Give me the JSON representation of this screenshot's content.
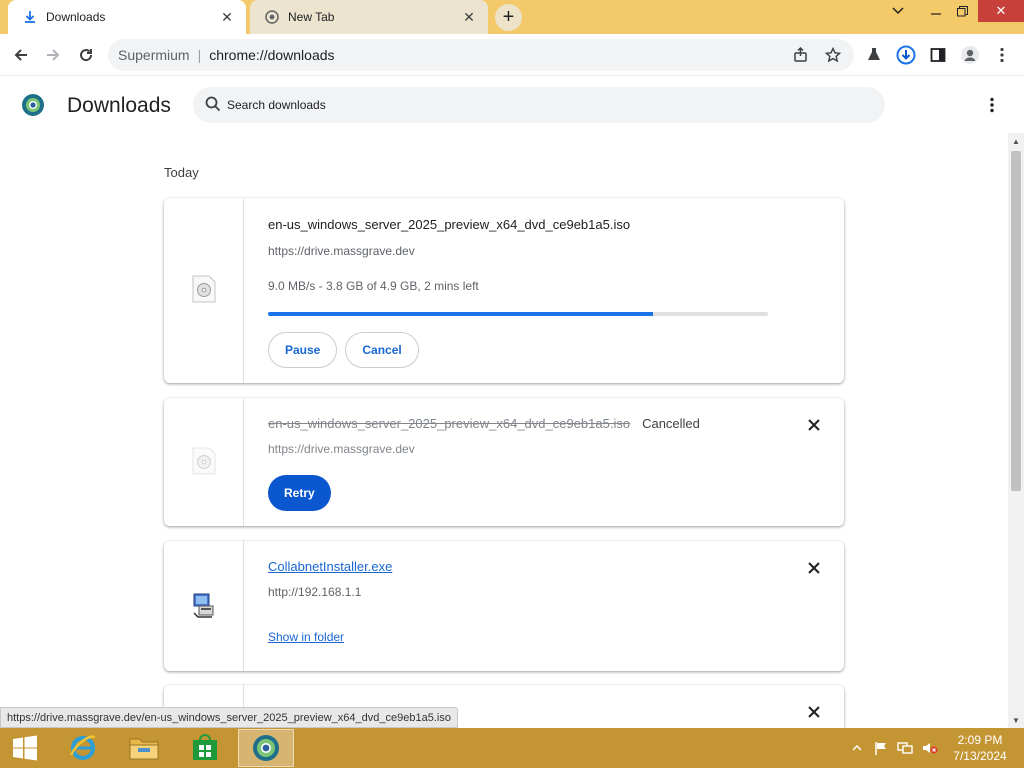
{
  "browser": {
    "tabs": [
      {
        "title": "Downloads",
        "icon": "download-icon",
        "active": true
      },
      {
        "title": "New Tab",
        "icon": "chrome-icon",
        "active": false
      }
    ],
    "brand": "Supermium",
    "url": "chrome://downloads"
  },
  "page": {
    "title": "Downloads",
    "search_placeholder": "Search downloads",
    "section": "Today"
  },
  "downloads": [
    {
      "file": "en-us_windows_server_2025_preview_x64_dvd_ce9eb1a5.iso",
      "source": "https://drive.massgrave.dev",
      "progress_text": "9.0 MB/s - 3.8 GB of 4.9 GB, 2 mins left",
      "progress_fraction": 0.77,
      "actions": [
        "Pause",
        "Cancel"
      ]
    },
    {
      "file": "en-us_windows_server_2025_preview_x64_dvd_ce9eb1a5.iso",
      "status": "Cancelled",
      "source": "https://drive.massgrave.dev",
      "action": "Retry"
    },
    {
      "file": "CollabnetInstaller.exe",
      "source": "http://192.168.1.1",
      "action": "Show in folder"
    }
  ],
  "status_url": "https://drive.massgrave.dev/en-us_windows_server_2025_preview_x64_dvd_ce9eb1a5.iso",
  "clock": {
    "time": "2:09 PM",
    "date": "7/13/2024"
  },
  "colors": {
    "accent": "#1a73e8",
    "primary_button": "#0b57d0",
    "titlebar": "#f4c969",
    "taskbar": "#c49533"
  }
}
